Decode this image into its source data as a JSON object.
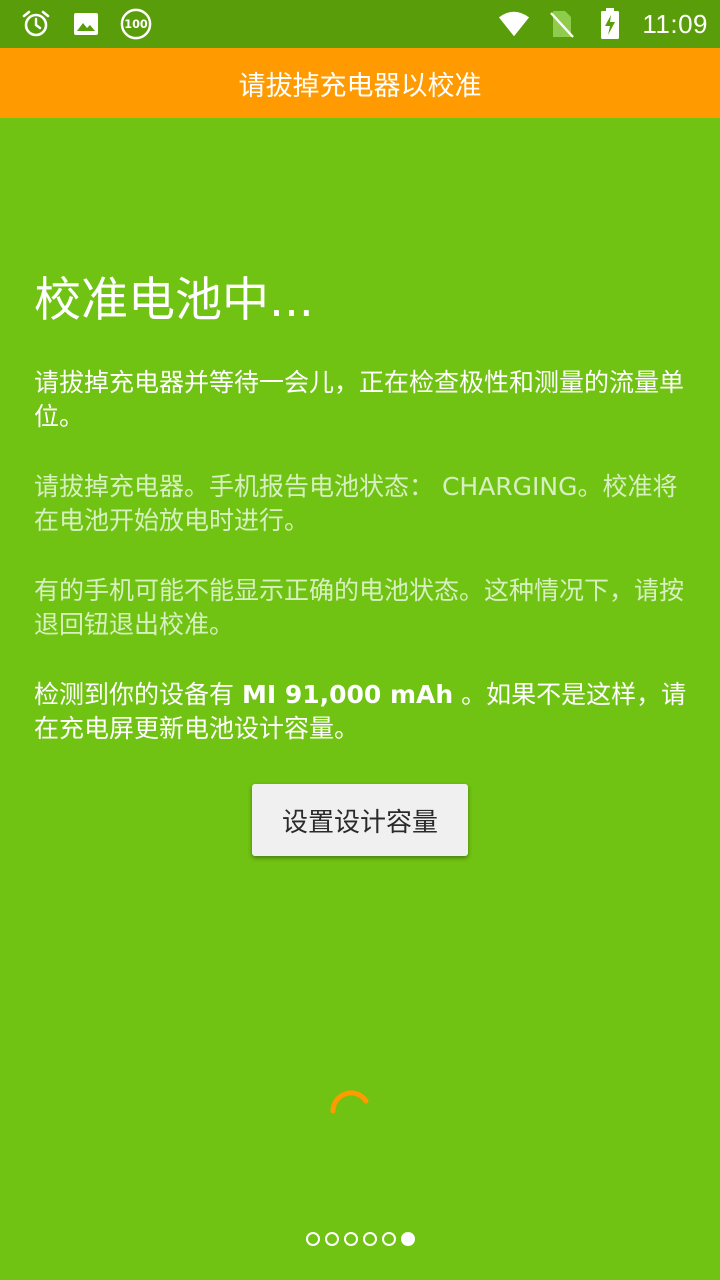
{
  "status_bar": {
    "time": "11:09",
    "battery_badge": "100",
    "left_icons": [
      "alarm-icon",
      "image-icon",
      "battery-100-badge-icon"
    ],
    "right_icons": [
      "wifi-icon",
      "no-sim-icon",
      "battery-charging-icon"
    ]
  },
  "notice": {
    "text": "请拔掉充电器以校准"
  },
  "main": {
    "title": "校准电池中...",
    "paragraph1": "请拔掉充电器并等待一会儿，正在检查极性和测量的流量单位。",
    "paragraph2": "请拔掉充电器。手机报告电池状态： CHARGING。校准将在电池开始放电时进行。",
    "paragraph3": "有的手机可能不能显示正确的电池状态。这种情况下，请按退回钮退出校准。",
    "paragraph4_prefix": "检测到你的设备有 ",
    "paragraph4_capacity": "MI 91,000 mAh",
    "paragraph4_suffix": " 。如果不是这样，请在充电屏更新电池设计容量。",
    "button_label": "设置设计容量"
  },
  "pager": {
    "total": 6,
    "active_index": 5
  },
  "colors": {
    "background": "#70c213",
    "status_bar": "#5a9d0a",
    "notice_bar": "#ff9a00",
    "spinner": "#ff9a00"
  }
}
